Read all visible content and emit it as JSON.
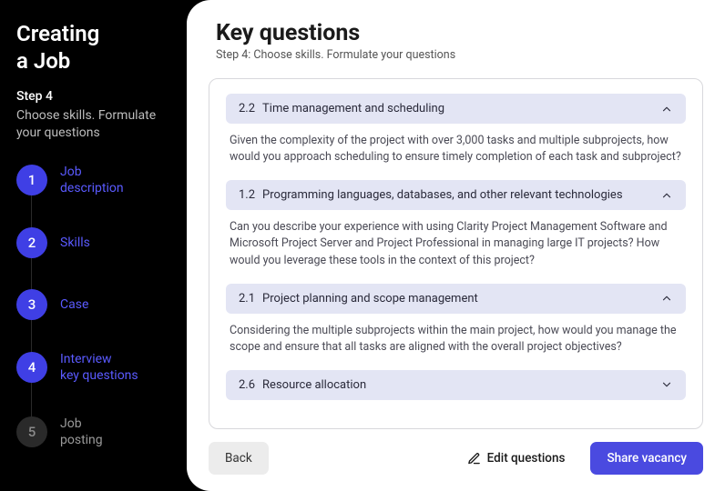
{
  "sidebar": {
    "title_line1": "Creating",
    "title_line2": "a Job",
    "step_label": "Step 4",
    "step_desc": "Choose skills. Formulate your questions",
    "steps": [
      {
        "num": "1",
        "label": "Job description",
        "active": true
      },
      {
        "num": "2",
        "label": "Skills",
        "active": true
      },
      {
        "num": "3",
        "label": "Case",
        "active": true
      },
      {
        "num": "4",
        "label": "Interview key questions",
        "active": true
      },
      {
        "num": "5",
        "label": "Job posting",
        "active": false
      }
    ]
  },
  "main": {
    "title": "Key questions",
    "subtitle": "Step 4: Choose skills. Formulate your questions"
  },
  "questions": [
    {
      "num": "2.2",
      "title": "Time management and scheduling",
      "expanded": true,
      "body": "Given the complexity of the project with over 3,000 tasks and multiple subprojects, how would you approach scheduling to ensure timely completion of each task and subproject?"
    },
    {
      "num": "1.2",
      "title": "Programming languages, databases, and other relevant technologies",
      "expanded": true,
      "body": "Can you describe your experience with using Clarity Project Management Software and Microsoft Project Server and Project Professional in managing large IT projects? How would you leverage these tools in the context of this project?"
    },
    {
      "num": "2.1",
      "title": "Project planning and scope management",
      "expanded": true,
      "body": "Considering the multiple subprojects within the main project, how would you manage the scope and ensure that all tasks are aligned with the overall project objectives?"
    },
    {
      "num": "2.6",
      "title": "Resource allocation",
      "expanded": false,
      "body": ""
    }
  ],
  "footer": {
    "back": "Back",
    "edit": "Edit questions",
    "share": "Share vacancy"
  }
}
